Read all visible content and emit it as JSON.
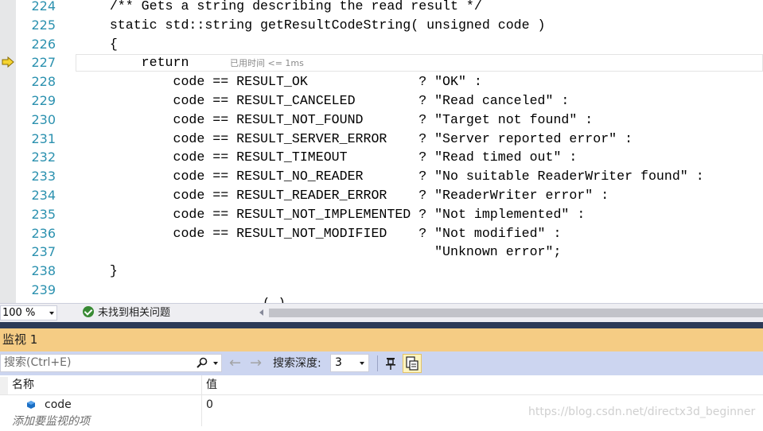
{
  "editor": {
    "lines": [
      {
        "num": "224",
        "text": "    /** Gets a string describing the read result */"
      },
      {
        "num": "225",
        "text": "    static std::string getResultCodeString( unsigned code )"
      },
      {
        "num": "226",
        "text": "    {"
      },
      {
        "num": "227",
        "text": "        return",
        "tip": "已用时间 <= 1ms",
        "current": true
      },
      {
        "num": "228",
        "text": "            code == RESULT_OK              ? \"OK\" :"
      },
      {
        "num": "229",
        "text": "            code == RESULT_CANCELED        ? \"Read canceled\" :"
      },
      {
        "num": "230",
        "text": "            code == RESULT_NOT_FOUND       ? \"Target not found\" :"
      },
      {
        "num": "231",
        "text": "            code == RESULT_SERVER_ERROR    ? \"Server reported error\" :"
      },
      {
        "num": "232",
        "text": "            code == RESULT_TIMEOUT         ? \"Read timed out\" :"
      },
      {
        "num": "233",
        "text": "            code == RESULT_NO_READER       ? \"No suitable ReaderWriter found\" :"
      },
      {
        "num": "234",
        "text": "            code == RESULT_READER_ERROR    ? \"ReaderWriter error\" :"
      },
      {
        "num": "235",
        "text": "            code == RESULT_NOT_IMPLEMENTED ? \"Not implemented\" :"
      },
      {
        "num": "236",
        "text": "            code == RESULT_NOT_MODIFIED    ? \"Not modified\" :"
      },
      {
        "num": "237",
        "text": "                                             \"Unknown error\";"
      },
      {
        "num": "238",
        "text": "    }"
      },
      {
        "num": "239",
        "text": ""
      }
    ],
    "cut_off_text": "(    )"
  },
  "status": {
    "zoom": "100 %",
    "issues_text": "未找到相关问题"
  },
  "watch": {
    "title": "监视 1",
    "search_placeholder": "搜索(Ctrl+E)",
    "depth_label": "搜索深度:",
    "depth_value": "3",
    "columns": {
      "name": "名称",
      "value": "值"
    },
    "rows": [
      {
        "name": "code",
        "value": "0"
      }
    ],
    "add_item_text": "添加要监视的项"
  },
  "watermark": "https://blog.csdn.net/directx3d_beginner",
  "colors": {
    "line_number": "#2b91af",
    "panel_title_bg": "#f5cc84",
    "toolbar_bg": "#ccd5f0",
    "divider": "#2d3b57"
  }
}
